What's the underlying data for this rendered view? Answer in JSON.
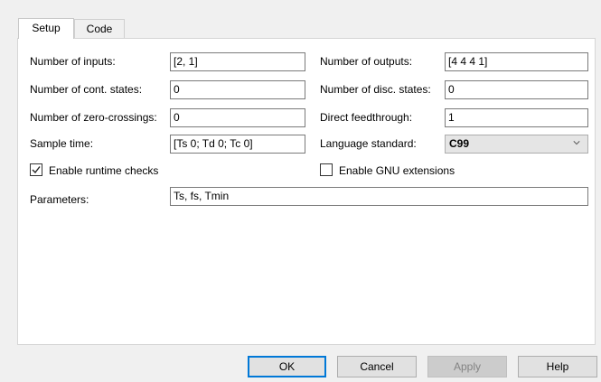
{
  "tabs": [
    {
      "label": "Setup",
      "active": true
    },
    {
      "label": "Code",
      "active": false
    }
  ],
  "fields": {
    "num_inputs": {
      "label": "Number of inputs:",
      "value": "[2, 1]"
    },
    "num_outputs": {
      "label": "Number of outputs:",
      "value": "[4 4 4 1]"
    },
    "cont_states": {
      "label": "Number of cont. states:",
      "value": "0"
    },
    "disc_states": {
      "label": "Number of disc. states:",
      "value": "0"
    },
    "zero_crossings": {
      "label": "Number of zero-crossings:",
      "value": "0"
    },
    "direct_feedthrough": {
      "label": "Direct feedthrough:",
      "value": "1"
    },
    "sample_time": {
      "label": "Sample time:",
      "value": "[Ts 0; Td 0; Tc 0]"
    },
    "language_standard": {
      "label": "Language standard:",
      "value": "C99",
      "icon": "chevron-down-icon"
    },
    "parameters": {
      "label": "Parameters:",
      "value": "Ts, fs, Tmin"
    }
  },
  "checks": {
    "runtime_checks": {
      "label": "Enable runtime checks",
      "checked": true
    },
    "gnu_extensions": {
      "label": "Enable GNU extensions",
      "checked": false
    }
  },
  "buttons": {
    "ok": "OK",
    "cancel": "Cancel",
    "apply": "Apply",
    "help": "Help"
  },
  "colors": {
    "focus_border": "#0078d7",
    "panel_bg": "#ffffff",
    "dialog_bg": "#f0f0f0"
  }
}
